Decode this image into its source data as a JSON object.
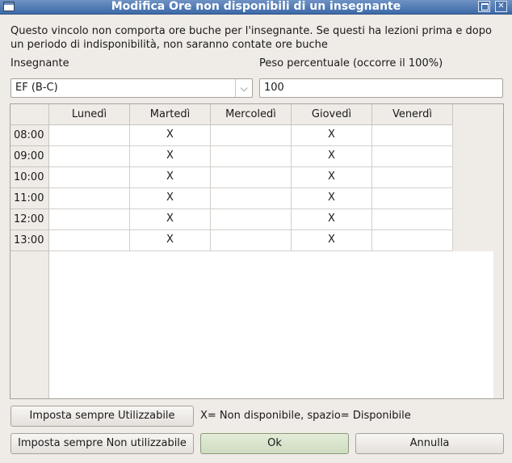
{
  "window": {
    "title": "Modifica Ore non disponibili di un insegnante",
    "maximize_icon": "maximize-icon",
    "close_icon": "close-icon",
    "close_glyph": "✕"
  },
  "info": {
    "line1": "Questo vincolo non comporta ore buche per l'insegnante. Se questi ha lezioni prima e dopo",
    "line2": "un periodo di indisponibilità, non saranno contate ore buche"
  },
  "teacher": {
    "label": "Insegnante",
    "value": "EF (B-C)",
    "arrow": "⌵"
  },
  "weight": {
    "label": "Peso percentuale (occorre il 100%)",
    "value": "100"
  },
  "table": {
    "columns": [
      "Lunedì",
      "Martedì",
      "Mercoledì",
      "Giovedì",
      "Venerdì"
    ],
    "rows": [
      {
        "hour": "08:00",
        "cells": [
          "",
          "X",
          "",
          "X",
          ""
        ]
      },
      {
        "hour": "09:00",
        "cells": [
          "",
          "X",
          "",
          "X",
          ""
        ]
      },
      {
        "hour": "10:00",
        "cells": [
          "",
          "X",
          "",
          "X",
          ""
        ]
      },
      {
        "hour": "11:00",
        "cells": [
          "",
          "X",
          "",
          "X",
          ""
        ]
      },
      {
        "hour": "12:00",
        "cells": [
          "",
          "X",
          "",
          "X",
          ""
        ]
      },
      {
        "hour": "13:00",
        "cells": [
          "",
          "X",
          "",
          "X",
          ""
        ]
      }
    ]
  },
  "buttons": {
    "set_all_usable": "Imposta sempre Utilizzabile",
    "set_all_unusable": "Imposta sempre Non utilizzabile",
    "ok": "Ok",
    "cancel": "Annulla"
  },
  "legend": "X= Non disponibile, spazio= Disponibile",
  "colors": {
    "titlebar": "#3c6aa8",
    "window_bg": "#efebe7",
    "ok_button": "#cfdcc1"
  }
}
